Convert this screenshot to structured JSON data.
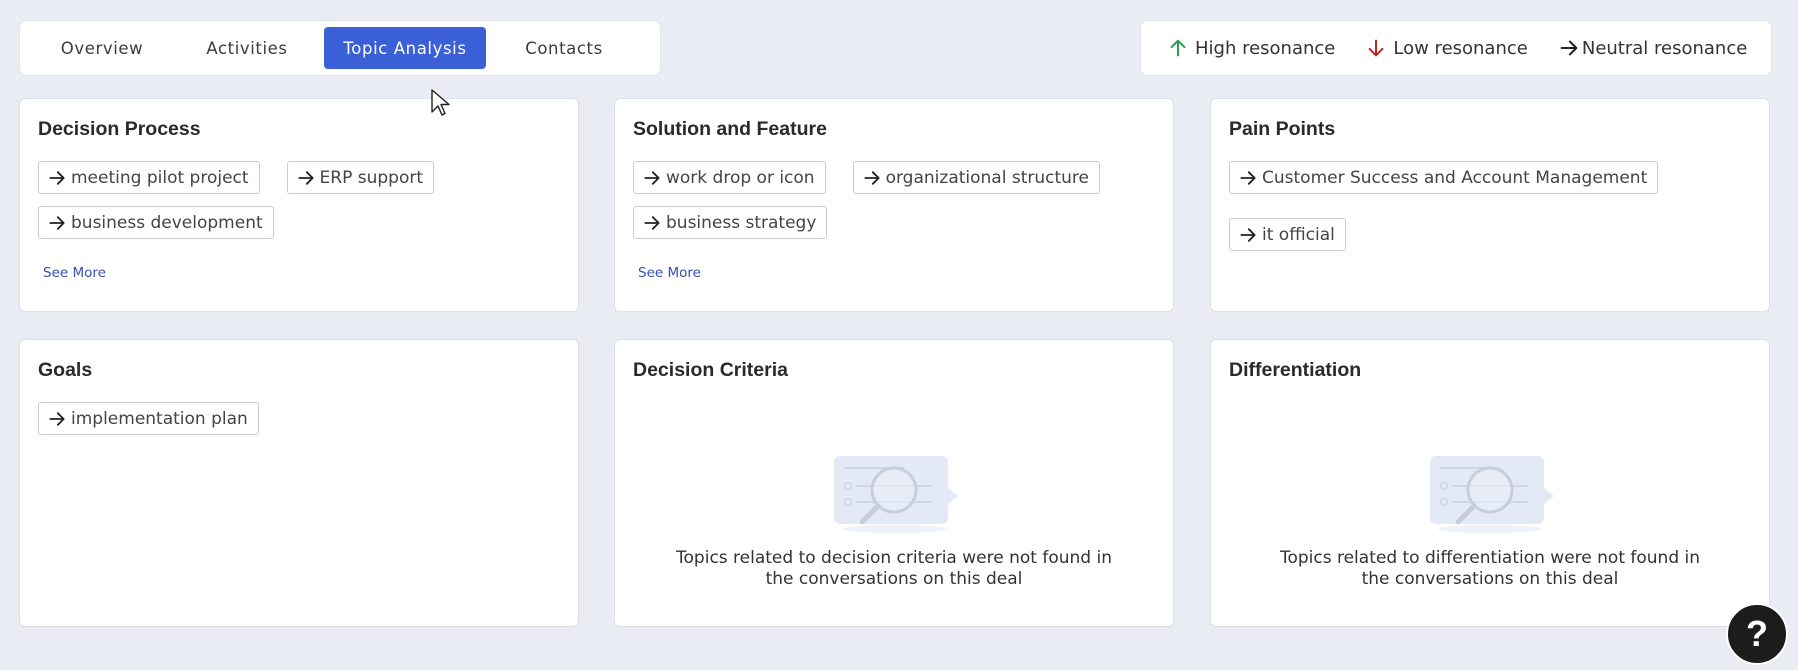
{
  "tabs": [
    {
      "label": "Overview",
      "active": false
    },
    {
      "label": "Activities",
      "active": false
    },
    {
      "label": "Topic Analysis",
      "active": true
    },
    {
      "label": "Contacts",
      "active": false
    }
  ],
  "legend": {
    "high": {
      "label": "High resonance",
      "icon": "arrow-up-icon",
      "color": "#2e9b4a"
    },
    "low": {
      "label": "Low resonance",
      "icon": "arrow-down-icon",
      "color": "#b3261e"
    },
    "neutral": {
      "label": "Neutral resonance",
      "icon": "arrow-right-icon",
      "color": "#222222"
    }
  },
  "cards": {
    "decision_process": {
      "title": "Decision Process",
      "topics": [
        "meeting pilot project",
        "ERP support",
        "business development"
      ],
      "see_more": "See More"
    },
    "solution_feature": {
      "title": "Solution and Feature",
      "topics": [
        "work drop or icon",
        "organizational structure",
        "business strategy"
      ],
      "see_more": "See More"
    },
    "pain_points": {
      "title": "Pain Points",
      "topics": [
        "Customer Success and Account Management",
        "it official"
      ]
    },
    "goals": {
      "title": "Goals",
      "topics": [
        "implementation plan"
      ]
    },
    "decision_criteria": {
      "title": "Decision Criteria",
      "empty_text": "Topics related to decision criteria were not found in the conversations on this deal"
    },
    "differentiation": {
      "title": "Differentiation",
      "empty_text": "Topics related to differentiation were not found in the conversations on this deal"
    }
  },
  "help": {
    "label": "?"
  },
  "colors": {
    "accent": "#3a5fd6",
    "background": "#e9ecf3",
    "link": "#3a4fb0"
  }
}
